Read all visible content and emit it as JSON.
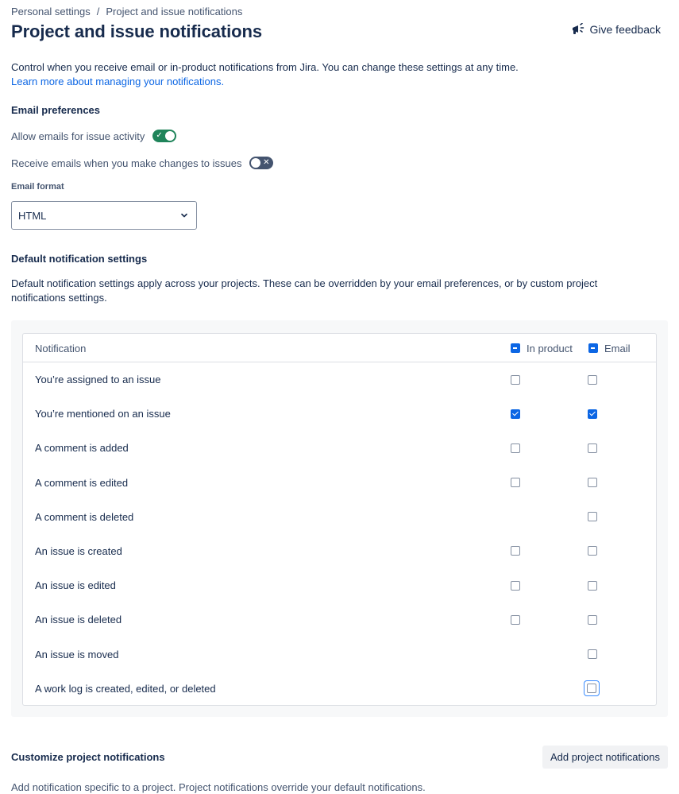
{
  "breadcrumb": {
    "parent": "Personal settings",
    "separator": "/",
    "current": "Project and issue notifications"
  },
  "page_title": "Project and issue notifications",
  "feedback": {
    "label": "Give feedback",
    "icon": "megaphone-icon"
  },
  "intro": {
    "text": "Control when you receive email or in-product notifications from Jira. You can change these settings at any time.",
    "link": "Learn more about managing your notifications."
  },
  "email_prefs": {
    "heading": "Email preferences",
    "allow_emails_label": "Allow emails for issue activity",
    "allow_emails_on": true,
    "receive_own_label": "Receive emails when you make changes to issues",
    "receive_own_on": false,
    "format_label": "Email format",
    "format_value": "HTML"
  },
  "defaults": {
    "heading": "Default notification settings",
    "description": "Default notification settings apply across your projects. These can be overridden by your email preferences, or by custom project notifications settings."
  },
  "table": {
    "col_notification": "Notification",
    "col_in_product": "In product",
    "col_email": "Email",
    "rows": [
      {
        "label": "You’re assigned to an issue",
        "in_product": false,
        "email": false
      },
      {
        "label": "You’re mentioned on an issue",
        "in_product": true,
        "email": true
      },
      {
        "label": "A comment is added",
        "in_product": false,
        "email": false
      },
      {
        "label": "A comment is edited",
        "in_product": false,
        "email": false
      },
      {
        "label": "A comment is deleted",
        "in_product": null,
        "email": false
      },
      {
        "label": "An issue is created",
        "in_product": false,
        "email": false
      },
      {
        "label": "An issue is edited",
        "in_product": false,
        "email": false
      },
      {
        "label": "An issue is deleted",
        "in_product": false,
        "email": false
      },
      {
        "label": "An issue is moved",
        "in_product": null,
        "email": false
      },
      {
        "label": "A work log is created, edited, or deleted",
        "in_product": null,
        "email": false,
        "focused": true
      }
    ]
  },
  "customize": {
    "heading": "Customize project notifications",
    "add_button": "Add project notifications",
    "partial_text": "Add notification specific to a project. Project notifications override your default notifications."
  },
  "colors": {
    "accent": "#0c66e4",
    "toggle_on": "#1f845a",
    "toggle_off": "#44546f",
    "text": "#172b4d"
  }
}
